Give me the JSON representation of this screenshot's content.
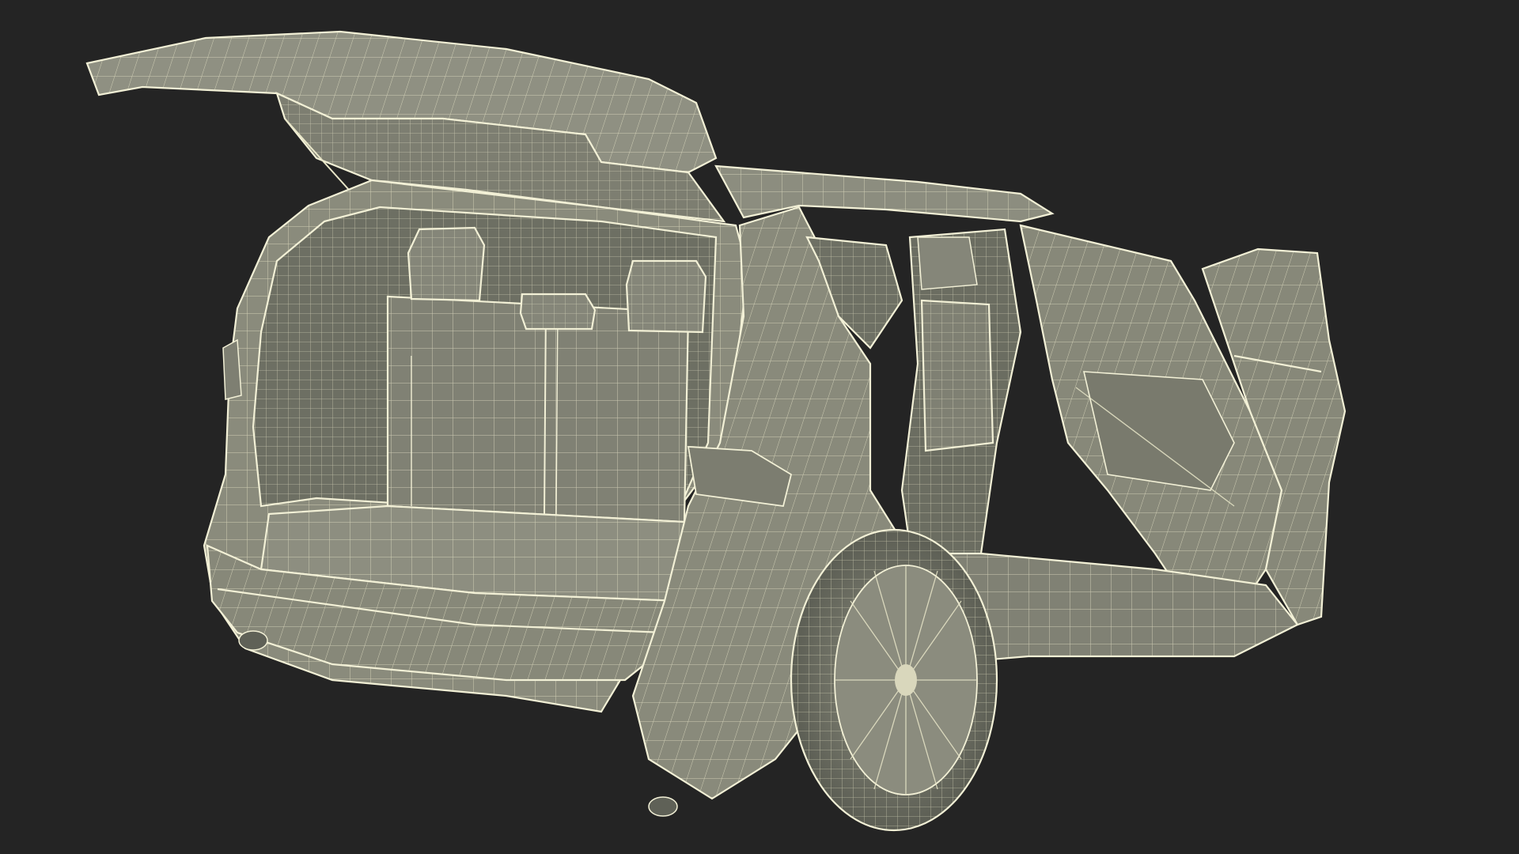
{
  "scene": {
    "background": "#242424",
    "surface_color": "#8a8b7c",
    "surface_dark": "#5f6157",
    "wire_color": "#e8e6c8"
  }
}
